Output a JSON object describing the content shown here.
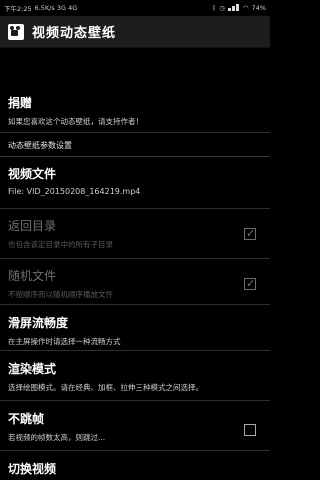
{
  "statusbar": {
    "time": "下午2:25",
    "network": "6.5K/s 3G 4G",
    "battery": "74%"
  },
  "appbar": {
    "title": "视频动态壁纸",
    "icon": "video-camera-icon"
  },
  "donate": {
    "title": "捐赠",
    "summary": "如果您喜欢这个动态壁纸，请支持作者！"
  },
  "section_header": "动态壁纸参数设置",
  "video_file": {
    "title": "视频文件",
    "summary": "File: VID_20150208_164219.mp4"
  },
  "loop_dir": {
    "title": "返回目录",
    "summary": "也包含该定目录中的所有子目录",
    "checked": true
  },
  "random_file": {
    "title": "随机文件",
    "summary": "不按顺序而以随机顺序播放文件",
    "checked": true
  },
  "smoothness": {
    "title": "滑屏流畅度",
    "summary": "在主屏操作时请选择一种流畅方式"
  },
  "render_mode": {
    "title": "渲染模式",
    "summary": "选择绘图模式。请在经典、加框、拉伸三种模式之间选择。"
  },
  "no_skip": {
    "title": "不跳帧",
    "summary": "若视频的帧数太高，则跳过...",
    "checked": false
  },
  "switch_video": {
    "title": "切换视频"
  },
  "colors": {
    "background": "#000000",
    "appbar": "#1d1d1d"
  }
}
